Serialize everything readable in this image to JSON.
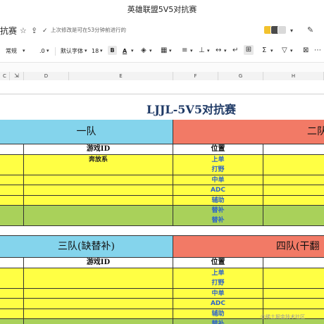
{
  "window": {
    "title": "英雄联盟5V5对抗赛"
  },
  "doc": {
    "name_fragment": "抗赛",
    "saved_status": "上次修改是可在53分钟前进行的"
  },
  "toolbar": {
    "style_select": "常规",
    "decimal": ".0",
    "font_select": "默认字体",
    "font_size": "18",
    "bold": "B",
    "font_color_letter": "A"
  },
  "columns": [
    "C",
    "D",
    "E",
    "F",
    "G",
    "H"
  ],
  "sheet": {
    "title": "LJJL-5V5对抗赛",
    "team1": "一队",
    "team2": "二队",
    "team3": "三队(缺替补)",
    "team4": "四队(干翻",
    "id_header": "游戏ID",
    "position_header": "位置",
    "team1_rows": [
      {
        "id": "奔放系",
        "position": "上单"
      },
      {
        "id": "",
        "position": "打野"
      },
      {
        "id": "",
        "position": "中单"
      },
      {
        "id": "",
        "position": "ADC"
      },
      {
        "id": "",
        "position": "辅助"
      },
      {
        "id": "",
        "position": "替补"
      },
      {
        "id": "",
        "position": "替补"
      }
    ],
    "team3_rows": [
      {
        "id": "",
        "position": "上单"
      },
      {
        "id": "",
        "position": "打野"
      },
      {
        "id": "",
        "position": "中单"
      },
      {
        "id": "",
        "position": "ADC"
      },
      {
        "id": "",
        "position": "辅助"
      },
      {
        "id": "",
        "position": "替补"
      }
    ]
  },
  "watermark": "@稀土掘金技术社区",
  "colors": {
    "yellow": "#ffff44",
    "green": "#a9d15a",
    "blue": "#84d4ec",
    "red": "#f27a66",
    "title": "#1f3a66",
    "position_text": "#2f66c8"
  }
}
